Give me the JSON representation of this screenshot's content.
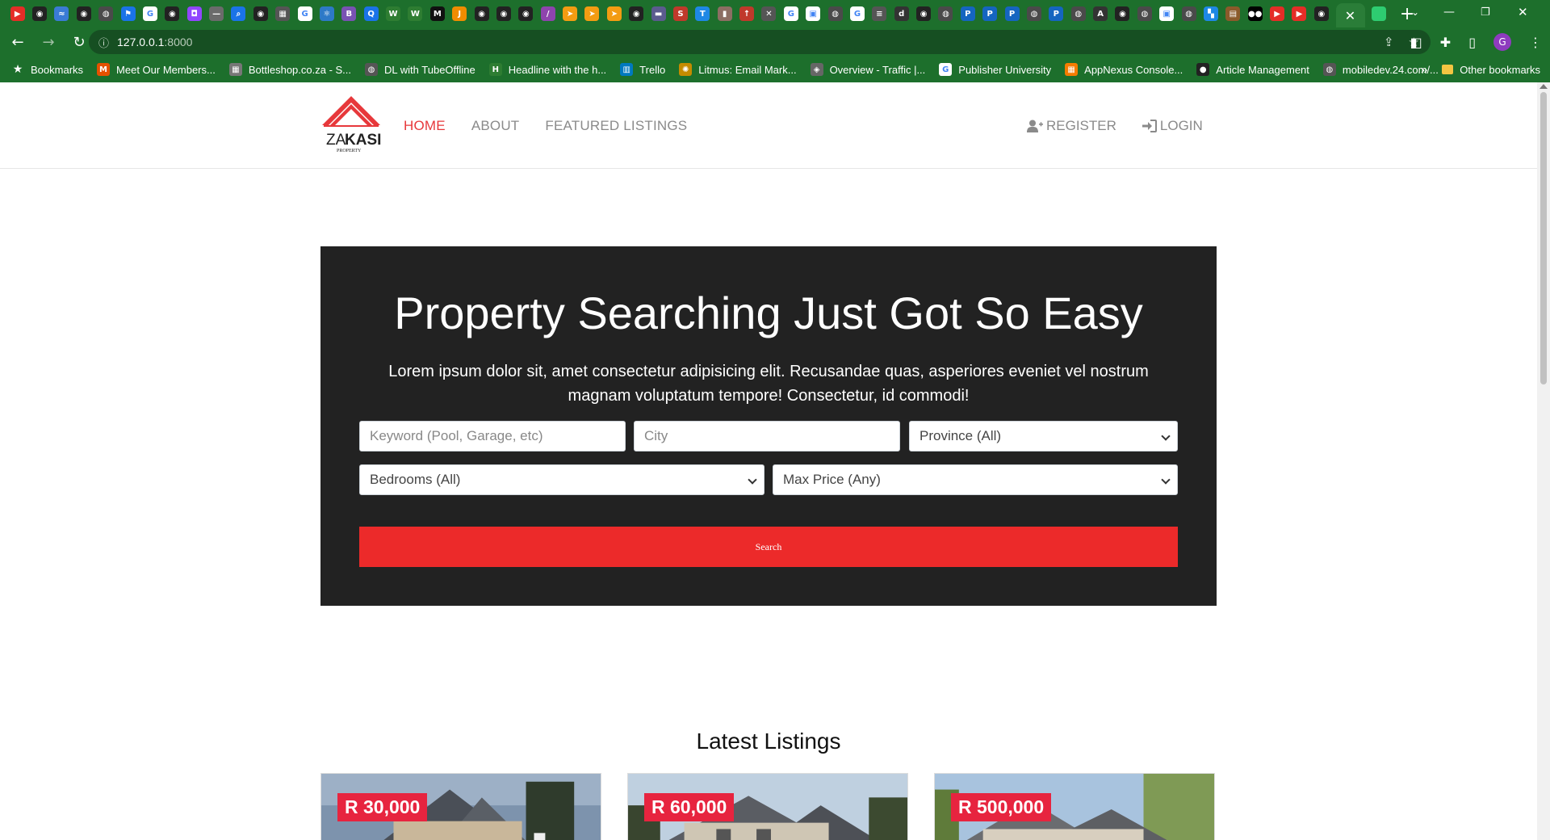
{
  "browser": {
    "tabs_favicons": [
      {
        "icon": "youtube-icon",
        "color": "#e52d27",
        "glyph": "▶"
      },
      {
        "icon": "github-icon",
        "color": "#222",
        "glyph": "◉"
      },
      {
        "icon": "stream-icon",
        "color": "#3a7bd5",
        "glyph": "≈"
      },
      {
        "icon": "github-icon",
        "color": "#222",
        "glyph": "◉"
      },
      {
        "icon": "globe-icon",
        "color": "#4a4a4a",
        "glyph": "◍"
      },
      {
        "icon": "flag-icon",
        "color": "#1a73e8",
        "glyph": "⚑"
      },
      {
        "icon": "google-icon",
        "color": "#ffffff",
        "glyph": "G"
      },
      {
        "icon": "github-icon",
        "color": "#222",
        "glyph": "◉"
      },
      {
        "icon": "twitch-icon",
        "color": "#9146ff",
        "glyph": "◘"
      },
      {
        "icon": "dash-icon",
        "color": "#6b6b6b",
        "glyph": "—"
      },
      {
        "icon": "search-icon",
        "color": "#1a73e8",
        "glyph": "⌕"
      },
      {
        "icon": "github-icon",
        "color": "#222",
        "glyph": "◉"
      },
      {
        "icon": "grid-icon",
        "color": "#555",
        "glyph": "▦"
      },
      {
        "icon": "google-icon",
        "color": "#ffffff",
        "glyph": "G"
      },
      {
        "icon": "react-icon",
        "color": "#2d79c7",
        "glyph": "⚛"
      },
      {
        "icon": "bootstrap-icon",
        "color": "#7952b3",
        "glyph": "B"
      },
      {
        "icon": "search-icon",
        "color": "#1a73e8",
        "glyph": "Q"
      },
      {
        "icon": "w-icon",
        "color": "#2e7d32",
        "glyph": "W"
      },
      {
        "icon": "w-icon",
        "color": "#2e7d32",
        "glyph": "W"
      },
      {
        "icon": "m-icon",
        "color": "#111",
        "glyph": "M"
      },
      {
        "icon": "orange-icon",
        "color": "#f08c00",
        "glyph": "J"
      },
      {
        "icon": "github-icon",
        "color": "#222",
        "glyph": "◉"
      },
      {
        "icon": "github-icon",
        "color": "#222",
        "glyph": "◉"
      },
      {
        "icon": "github-icon",
        "color": "#222",
        "glyph": "◉"
      },
      {
        "icon": "slash-icon",
        "color": "#8e44ad",
        "glyph": "/"
      },
      {
        "icon": "arrow-icon",
        "color": "#f39c12",
        "glyph": "➤"
      },
      {
        "icon": "arrow-icon",
        "color": "#f39c12",
        "glyph": "➤"
      },
      {
        "icon": "arrow-icon",
        "color": "#f39c12",
        "glyph": "➤"
      },
      {
        "icon": "github-icon",
        "color": "#222",
        "glyph": "◉"
      },
      {
        "icon": "box-icon",
        "color": "#5b5b8f",
        "glyph": "▬"
      },
      {
        "icon": "red-icon",
        "color": "#c0392b",
        "glyph": "S"
      },
      {
        "icon": "t-icon",
        "color": "#1e88e5",
        "glyph": "T"
      },
      {
        "icon": "doc-icon",
        "color": "#8d6e63",
        "glyph": "▮"
      },
      {
        "icon": "red-icon",
        "color": "#c0392b",
        "glyph": "↑"
      },
      {
        "icon": "x-icon",
        "color": "#555",
        "glyph": "✕"
      },
      {
        "icon": "google-icon",
        "color": "#ffffff",
        "glyph": "G"
      },
      {
        "icon": "image-icon",
        "color": "#ffffff",
        "glyph": "▣"
      },
      {
        "icon": "globe-icon",
        "color": "#4a4a4a",
        "glyph": "◍"
      },
      {
        "icon": "google-icon",
        "color": "#ffffff",
        "glyph": "G"
      },
      {
        "icon": "stack-icon",
        "color": "#555",
        "glyph": "≡"
      },
      {
        "icon": "d-icon",
        "color": "#333",
        "glyph": "d"
      },
      {
        "icon": "github-icon",
        "color": "#222",
        "glyph": "◉"
      },
      {
        "icon": "globe-icon",
        "color": "#4a4a4a",
        "glyph": "◍"
      },
      {
        "icon": "paypal-icon",
        "color": "#1565c0",
        "glyph": "P"
      },
      {
        "icon": "paypal-icon",
        "color": "#1565c0",
        "glyph": "P"
      },
      {
        "icon": "paypal-icon",
        "color": "#1565c0",
        "glyph": "P"
      },
      {
        "icon": "globe-icon",
        "color": "#4a4a4a",
        "glyph": "◍"
      },
      {
        "icon": "paypal-icon",
        "color": "#1565c0",
        "glyph": "P"
      },
      {
        "icon": "globe-icon",
        "color": "#4a4a4a",
        "glyph": "◍"
      },
      {
        "icon": "a-icon",
        "color": "#333",
        "glyph": "A"
      },
      {
        "icon": "github-icon",
        "color": "#222",
        "glyph": "◉"
      },
      {
        "icon": "globe-icon",
        "color": "#4a4a4a",
        "glyph": "◍"
      },
      {
        "icon": "image-icon",
        "color": "#ffffff",
        "glyph": "▣"
      },
      {
        "icon": "globe-icon",
        "color": "#4a4a4a",
        "glyph": "◍"
      },
      {
        "icon": "blue-icon",
        "color": "#1e88e5",
        "glyph": "▚"
      },
      {
        "icon": "box-icon",
        "color": "#8b5a2b",
        "glyph": "▤"
      },
      {
        "icon": "medium-icon",
        "color": "#000",
        "glyph": "●●"
      },
      {
        "icon": "youtube-icon",
        "color": "#e52d27",
        "glyph": "▶"
      },
      {
        "icon": "youtube-icon",
        "color": "#e52d27",
        "glyph": "▶"
      },
      {
        "icon": "github-icon",
        "color": "#222",
        "glyph": "◉"
      }
    ],
    "active_tab": {
      "close_glyph": "✕"
    },
    "new_tab_glyph": "+",
    "address": {
      "host": "127.0.0.1",
      "port": ":8000"
    },
    "bookmarks": [
      {
        "label": "Bookmarks",
        "icon": "star-icon",
        "color": "#1d6f2c",
        "glyph": "★"
      },
      {
        "label": "Meet Our Members...",
        "icon": "members-icon",
        "color": "#e65100",
        "glyph": "M"
      },
      {
        "label": "Bottleshop.co.za - S...",
        "icon": "bottleshop-icon",
        "color": "#777",
        "glyph": "▦"
      },
      {
        "label": "DL with TubeOffline",
        "icon": "globe-icon",
        "color": "#555",
        "glyph": "◍"
      },
      {
        "label": "Headline with the h...",
        "icon": "headline-icon",
        "color": "#2e7d32",
        "glyph": "H"
      },
      {
        "label": "Trello",
        "icon": "trello-icon",
        "color": "#0079bf",
        "glyph": "▥"
      },
      {
        "label": "Litmus: Email Mark...",
        "icon": "litmus-icon",
        "color": "#c58b00",
        "glyph": "✺"
      },
      {
        "label": "Overview - Traffic |...",
        "icon": "traffic-icon",
        "color": "#666",
        "glyph": "◈"
      },
      {
        "label": "Publisher University",
        "icon": "google-icon",
        "color": "#ffffff",
        "glyph": "G"
      },
      {
        "label": "AppNexus Console...",
        "icon": "appnexus-icon",
        "color": "#f57c00",
        "glyph": "▦"
      },
      {
        "label": "Article Management",
        "icon": "article-icon",
        "color": "#222",
        "glyph": "●"
      },
      {
        "label": "mobiledev.24.com/...",
        "icon": "globe-icon",
        "color": "#555",
        "glyph": "◍"
      }
    ],
    "bookmarks_overflow_glyph": "»",
    "other_bookmarks": "Other bookmarks",
    "profile_initial": "G"
  },
  "site": {
    "brand": {
      "name_light": "ZA",
      "name_bold": "KASI",
      "tagline": "PROPERTY"
    },
    "nav": [
      {
        "label": "HOME",
        "active": true
      },
      {
        "label": "ABOUT",
        "active": false
      },
      {
        "label": "FEATURED LISTINGS",
        "active": false
      }
    ],
    "auth": {
      "register": "REGISTER",
      "login": "LOGIN"
    },
    "hero": {
      "title": "Property Searching Just Got So Easy",
      "text": "Lorem ipsum dolor sit, amet consectetur adipisicing elit. Recusandae quas, asperiores eveniet vel nostrum magnam voluptatum tempore! Consectetur, id commodi!",
      "keyword_placeholder": "Keyword (Pool, Garage, etc)",
      "city_placeholder": "City",
      "province_value": "Province (All)",
      "bedrooms_value": "Bedrooms (All)",
      "max_price_value": "Max Price (Any)",
      "search_label": "Search"
    },
    "latest": {
      "title": "Latest Listings",
      "listings": [
        {
          "price": "R 30,000"
        },
        {
          "price": "R 60,000"
        },
        {
          "price": "R 500,000"
        }
      ]
    },
    "colors": {
      "accent": "#e7383b",
      "hero_bg": "#222222",
      "search_button": "#ec2a2a",
      "price_badge": "#e7243f",
      "chrome": "#1d6f2c"
    }
  }
}
